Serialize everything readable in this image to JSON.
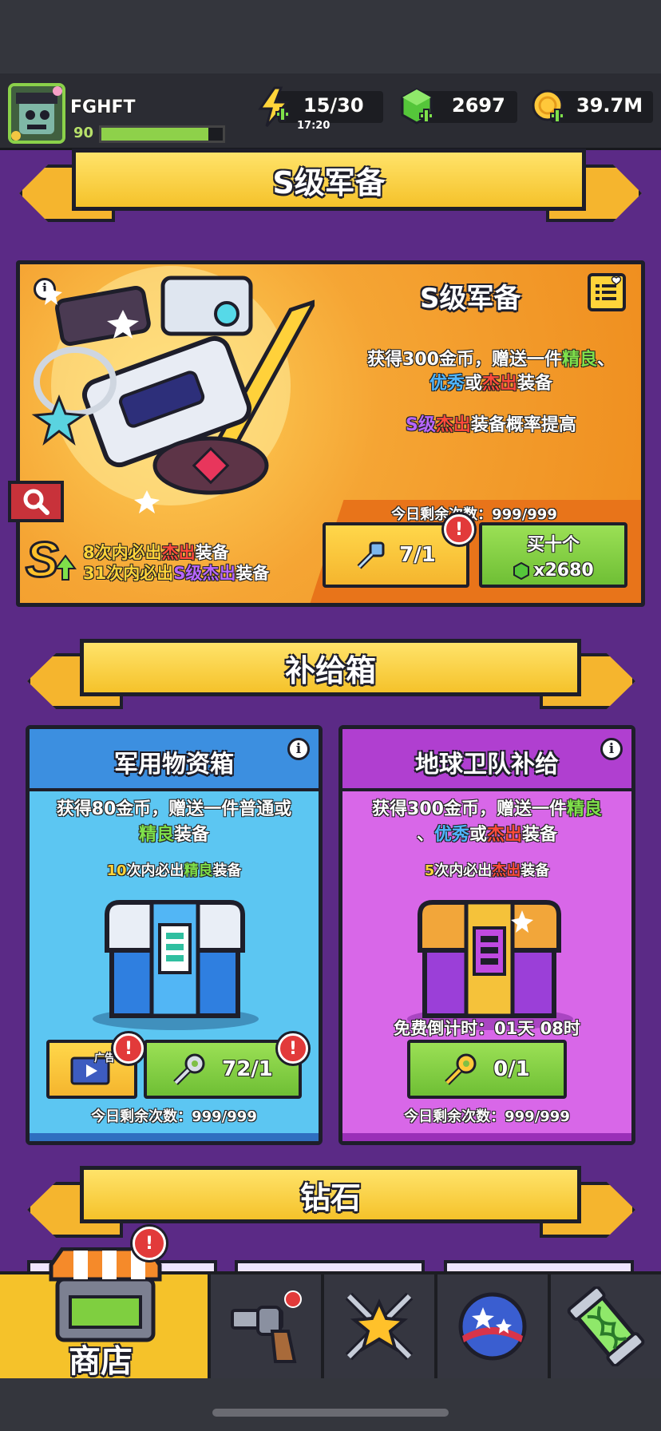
{
  "hud": {
    "player_name": "FGHFT",
    "level": "90",
    "xp_fraction": 0.88,
    "energy": "15/30",
    "energy_timer": "17:20",
    "gems": "2697",
    "coins": "39.7M"
  },
  "s_gear": {
    "banner_title": "S级军备",
    "panel_title": "S级军备",
    "desc_line1_a": "获得300金币，赠送一件",
    "desc_line1_b": "精良",
    "desc_line1_c": "、",
    "desc_line2_a": "优秀",
    "desc_line2_b": "或",
    "desc_line2_c": "杰出",
    "desc_line2_d": "装备",
    "boost_a": "S级",
    "boost_b": "杰出",
    "boost_c": "装备概率提高",
    "pity1_a": "8次内必出",
    "pity1_b": "杰出",
    "pity1_c": "装备",
    "pity2_a": "31次内必出",
    "pity2_b": "S级杰出",
    "pity2_c": "装备",
    "daily_remaining": "今日剩余次数：999/999",
    "key_count": "7/1",
    "buy_ten_label": "买十个",
    "buy_ten_price": "x2680"
  },
  "supply": {
    "banner_title": "补给箱",
    "military": {
      "title": "军用物资箱",
      "desc_a": "获得80金币，赠送一件普通或",
      "desc_b": "精良",
      "desc_c": "装备",
      "pity_a": "10",
      "pity_b": "次内必出",
      "pity_c": "精良",
      "pity_d": "装备",
      "ad_label": "广告",
      "key_count": "72/1",
      "daily_remaining": "今日剩余次数：999/999"
    },
    "earth": {
      "title": "地球卫队补给",
      "desc_a": "获得300金币，赠送一件",
      "desc_b": "精良",
      "desc_c": "、",
      "desc_d": "优秀",
      "desc_e": "或",
      "desc_f": "杰出",
      "desc_g": "装备",
      "pity_a": "5",
      "pity_b": "次内必出",
      "pity_c": "杰出",
      "pity_d": "装备",
      "countdown": "免费倒计时：01天 08时",
      "key_count": "0/1",
      "daily_remaining": "今日剩余次数：999/999"
    }
  },
  "diamond": {
    "banner_title": "钻石"
  },
  "nav": {
    "shop_label": "商店",
    "badge": "!"
  },
  "badges": {
    "alert": "!"
  },
  "colors": {
    "background": "#5b2a86",
    "banner": "#f5c22a",
    "green_button": "#7fcf40",
    "military_card": "#5cc6f2",
    "earth_card": "#d867e8"
  }
}
